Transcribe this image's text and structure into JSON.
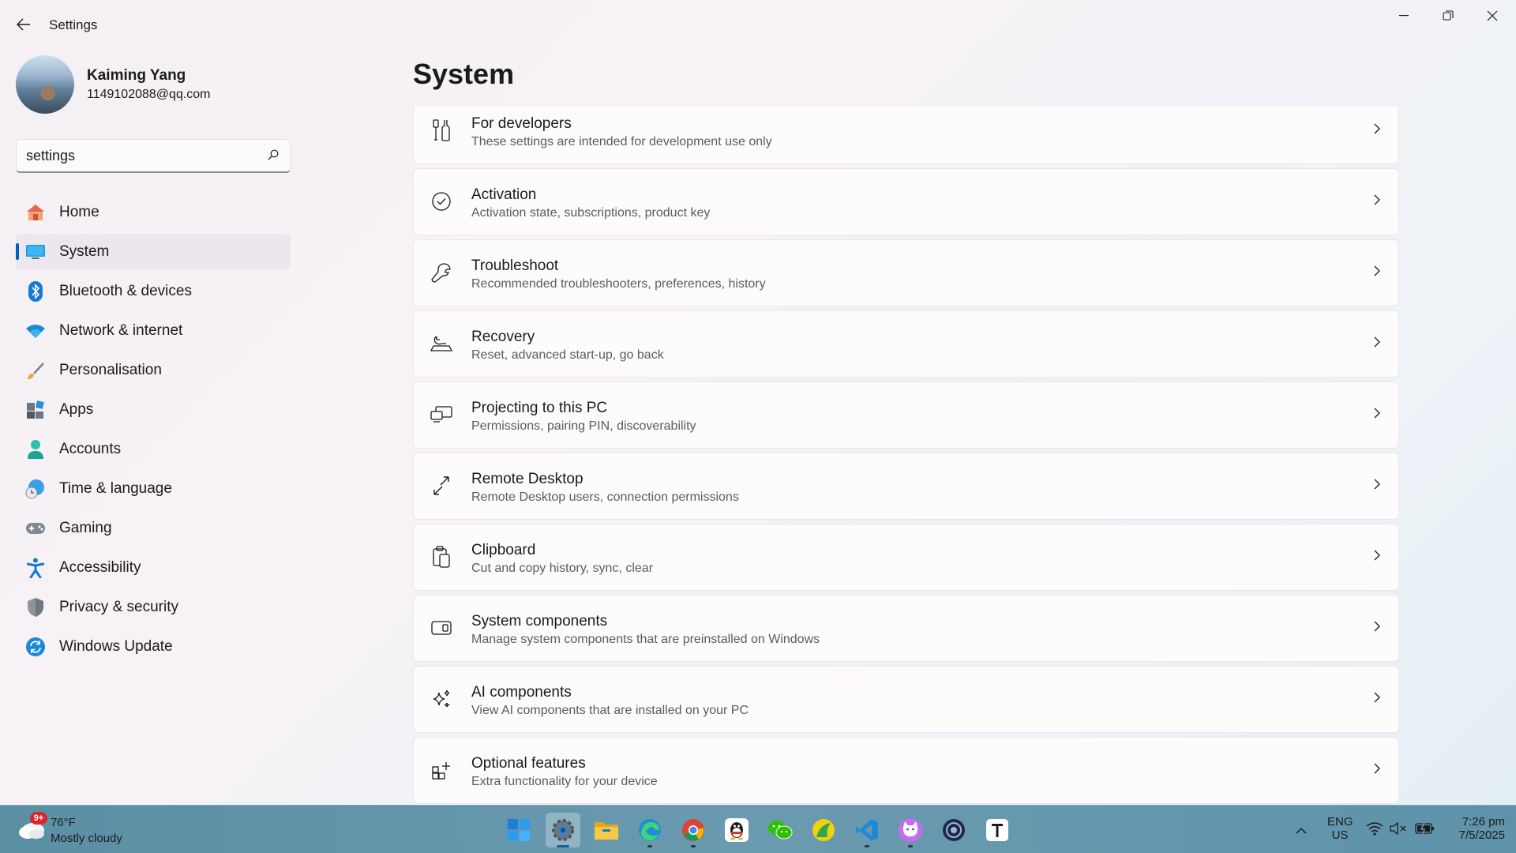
{
  "window": {
    "title": "Settings"
  },
  "profile": {
    "name": "Kaiming Yang",
    "email": "1149102088@qq.com"
  },
  "search": {
    "value": "settings"
  },
  "nav": {
    "items": [
      {
        "label": "Home",
        "icon": "home-icon"
      },
      {
        "label": "System",
        "icon": "system-icon",
        "active": true
      },
      {
        "label": "Bluetooth & devices",
        "icon": "bluetooth-icon"
      },
      {
        "label": "Network & internet",
        "icon": "wifi-icon"
      },
      {
        "label": "Personalisation",
        "icon": "brush-icon"
      },
      {
        "label": "Apps",
        "icon": "apps-icon"
      },
      {
        "label": "Accounts",
        "icon": "accounts-icon"
      },
      {
        "label": "Time & language",
        "icon": "time-language-icon"
      },
      {
        "label": "Gaming",
        "icon": "gamepad-icon"
      },
      {
        "label": "Accessibility",
        "icon": "accessibility-icon"
      },
      {
        "label": "Privacy & security",
        "icon": "shield-icon"
      },
      {
        "label": "Windows Update",
        "icon": "update-icon"
      }
    ]
  },
  "main": {
    "title": "System",
    "cards": [
      {
        "title": "For developers",
        "subtitle": "These settings are intended for development use only",
        "icon": "developer-tools-icon"
      },
      {
        "title": "Activation",
        "subtitle": "Activation state, subscriptions, product key",
        "icon": "check-circle-icon"
      },
      {
        "title": "Troubleshoot",
        "subtitle": "Recommended troubleshooters, preferences, history",
        "icon": "wrench-icon"
      },
      {
        "title": "Recovery",
        "subtitle": "Reset, advanced start-up, go back",
        "icon": "recovery-icon"
      },
      {
        "title": "Projecting to this PC",
        "subtitle": "Permissions, pairing PIN, discoverability",
        "icon": "projecting-icon"
      },
      {
        "title": "Remote Desktop",
        "subtitle": "Remote Desktop users, connection permissions",
        "icon": "remote-desktop-icon"
      },
      {
        "title": "Clipboard",
        "subtitle": "Cut and copy history, sync, clear",
        "icon": "clipboard-icon"
      },
      {
        "title": "System components",
        "subtitle": "Manage system components that are preinstalled on Windows",
        "icon": "system-components-icon"
      },
      {
        "title": "AI components",
        "subtitle": "View AI components that are installed on your PC",
        "icon": "sparkle-icon"
      },
      {
        "title": "Optional features",
        "subtitle": "Extra functionality for your device",
        "icon": "optional-features-icon"
      }
    ]
  },
  "taskbar": {
    "weather": {
      "badge": "9+",
      "temp": "76°F",
      "desc": "Mostly cloudy"
    },
    "apps": [
      "start-icon",
      "settings-icon",
      "file-explorer-icon",
      "edge-icon",
      "chrome-icon",
      "qq-icon",
      "wechat-icon",
      "app-icon",
      "vscode-icon",
      "cat-app-icon",
      "app-icon",
      "typora-icon"
    ],
    "tray": {
      "lang_top": "ENG",
      "lang_bottom": "US",
      "time": "7:26 pm",
      "date": "7/5/2025"
    }
  },
  "colors": {
    "accent": "#005fb8",
    "taskbar": "#6a9ab0"
  }
}
